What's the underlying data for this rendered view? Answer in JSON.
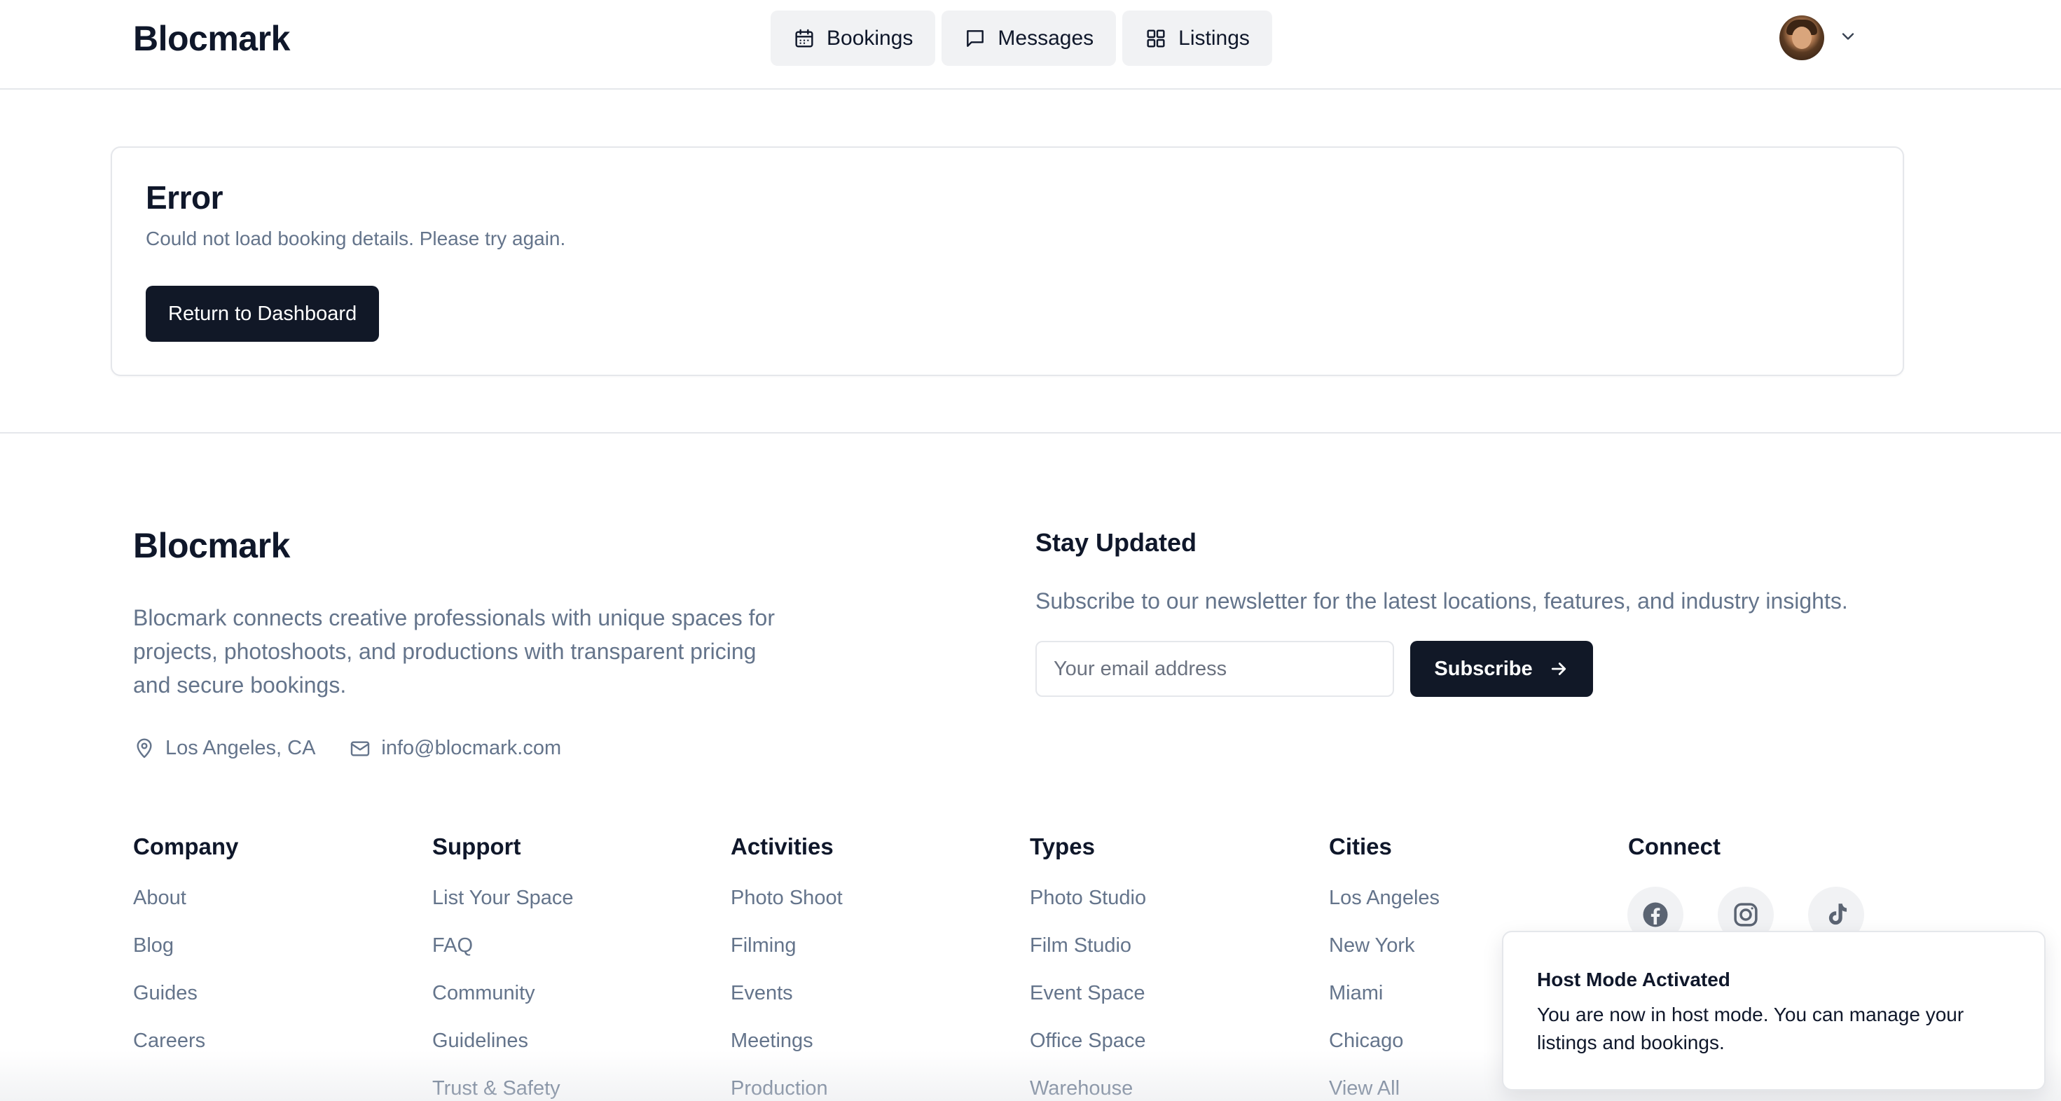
{
  "header": {
    "brand": "Blocmark",
    "nav": [
      {
        "label": "Bookings",
        "icon": "calendar-icon"
      },
      {
        "label": "Messages",
        "icon": "message-icon"
      },
      {
        "label": "Listings",
        "icon": "grid-icon"
      }
    ]
  },
  "error": {
    "title": "Error",
    "message": "Could not load booking details. Please try again.",
    "button_label": "Return to Dashboard"
  },
  "footer": {
    "brand": "Blocmark",
    "description": "Blocmark connects creative professionals with unique spaces for projects, photoshoots, and productions with transparent pricing and secure bookings.",
    "location": "Los Angeles, CA",
    "email": "info@blocmark.com",
    "newsletter": {
      "title": "Stay Updated",
      "description": "Subscribe to our newsletter for the latest locations, features, and industry insights.",
      "placeholder": "Your email address",
      "button_label": "Subscribe"
    },
    "columns": [
      {
        "title": "Company",
        "links": [
          "About",
          "Blog",
          "Guides",
          "Careers"
        ]
      },
      {
        "title": "Support",
        "links": [
          "List Your Space",
          "FAQ",
          "Community",
          "Guidelines",
          "Trust & Safety"
        ]
      },
      {
        "title": "Activities",
        "links": [
          "Photo Shoot",
          "Filming",
          "Events",
          "Meetings",
          "Production"
        ]
      },
      {
        "title": "Types",
        "links": [
          "Photo Studio",
          "Film Studio",
          "Event Space",
          "Office Space",
          "Warehouse"
        ]
      },
      {
        "title": "Cities",
        "links": [
          "Los Angeles",
          "New York",
          "Miami",
          "Chicago",
          "View All"
        ]
      },
      {
        "title": "Connect",
        "links": []
      }
    ],
    "social": [
      "facebook-icon",
      "instagram-icon",
      "tiktok-icon"
    ]
  },
  "toast": {
    "title": "Host Mode Activated",
    "body": "You are now in host mode. You can manage your listings and bookings."
  }
}
